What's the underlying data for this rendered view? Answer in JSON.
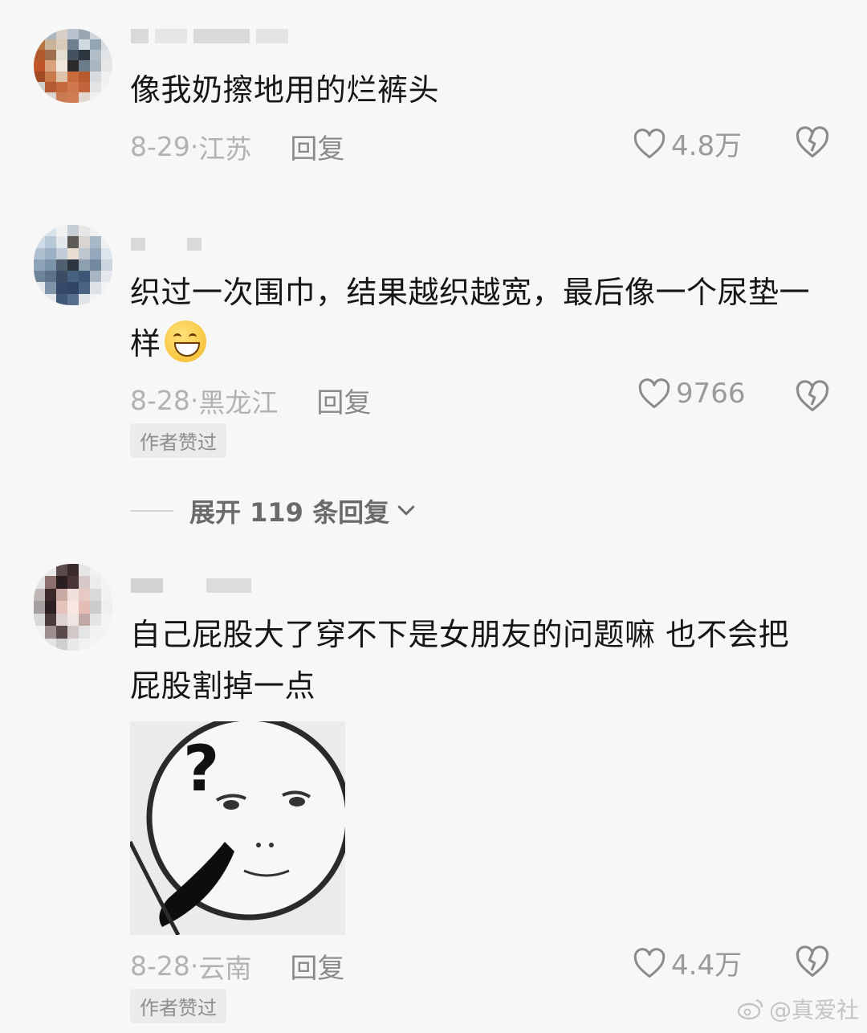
{
  "comments": [
    {
      "text": "像我奶擦地用的烂裤头",
      "date": "8-29",
      "location": "江苏",
      "reply_label": "回复",
      "likes": "4.8万",
      "author_liked": ""
    },
    {
      "text": "织过一次围巾，结果越织越宽，最后像一个尿垫一样",
      "date": "8-28",
      "location": "黑龙江",
      "reply_label": "回复",
      "likes": "9766",
      "author_liked": "作者赞过"
    },
    {
      "text": "自己屁股大了穿不下是女朋友的问题嘛 也不会把屁股割掉一点",
      "date": "8-28",
      "location": "云南",
      "reply_label": "回复",
      "likes": "4.4万",
      "author_liked": "作者赞过"
    }
  ],
  "expand_replies": {
    "label": "展开 119 条回复"
  },
  "watermark": "@真爱社",
  "icons": {
    "like": "heart-outline-icon",
    "dislike": "broken-heart-icon",
    "expand": "chevron-down-icon",
    "emoji": "smiling-face-emoji",
    "watermark": "weibo-logo-icon"
  },
  "colors": {
    "background": "#f7f7f7",
    "text": "#161616",
    "meta": "#b2b2b2",
    "reply": "#8a8a8a"
  }
}
